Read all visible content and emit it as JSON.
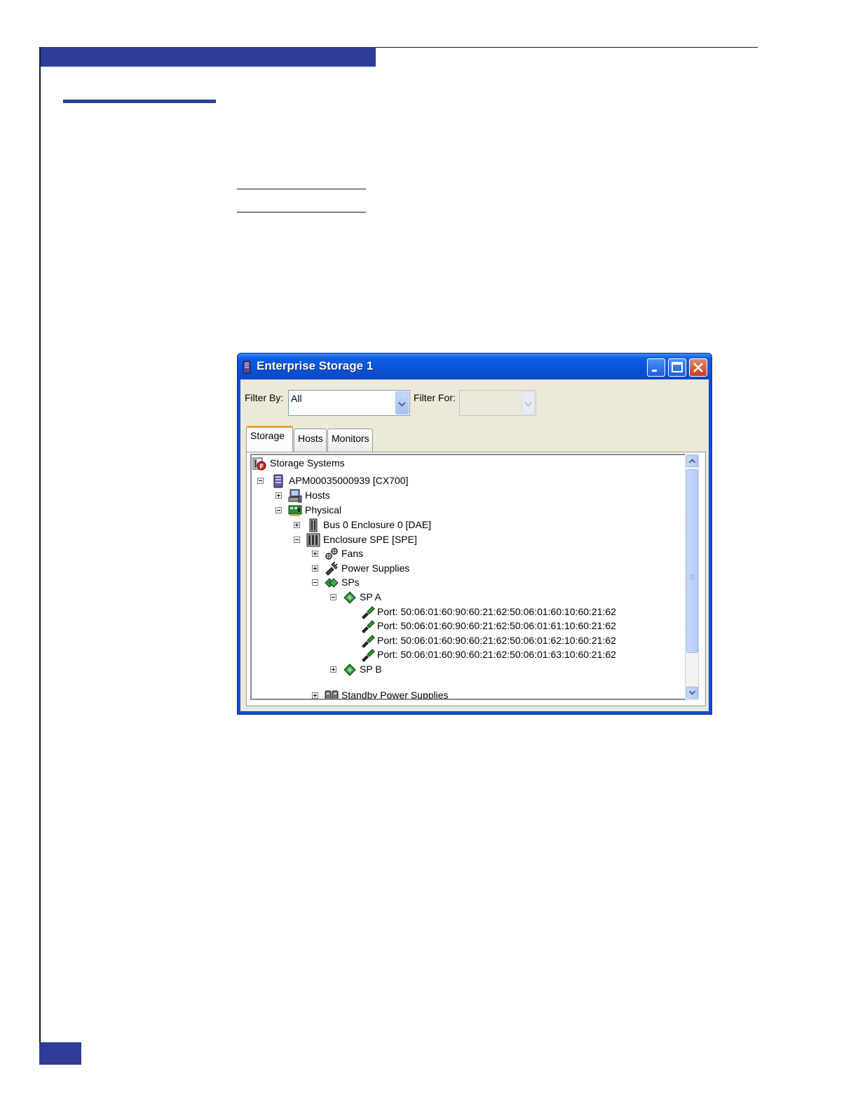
{
  "window": {
    "title": "Enterprise Storage 1",
    "filter_by_label": "Filter By:",
    "filter_by_value": "All",
    "filter_for_label": "Filter For:",
    "filter_for_value": ""
  },
  "tabs": [
    {
      "label": "Storage",
      "active": true
    },
    {
      "label": "Hosts",
      "active": false
    },
    {
      "label": "Monitors",
      "active": false
    }
  ],
  "tree": {
    "root": "Storage Systems",
    "system": "APM00035000939 [CX700]",
    "hosts": "Hosts",
    "physical": "Physical",
    "bus": "Bus 0 Enclosure 0 [DAE]",
    "enclosure": "Enclosure SPE [SPE]",
    "fans": "Fans",
    "power_supplies": "Power Supplies",
    "sps": "SPs",
    "sp_a": "SP A",
    "ports": [
      "Port: 50:06:01:60:90:60:21:62:50:06:01:60:10:60:21:62",
      "Port: 50:06:01:60:90:60:21:62:50:06:01:61:10:60:21:62",
      "Port: 50:06:01:60:90:60:21:62:50:06:01:62:10:60:21:62",
      "Port: 50:06:01:60:90:60:21:62:50:06:01:63:10:60:21:62"
    ],
    "sp_b": "SP B",
    "standby": "Standby Power Supplies"
  },
  "icons": {
    "system": "storage-tower-icon",
    "hosts": "host-computer-icon",
    "physical": "circuit-board-icon",
    "fans": "fan-icon",
    "power": "power-supply-icon",
    "sp": "storage-processor-icon",
    "port": "port-icon",
    "standby": "standby-power-icon"
  },
  "colors": {
    "brand_blue": "#2e3d98",
    "titlebar_blue": "#0a52d6",
    "active_tab_accent": "#f3a12b"
  }
}
